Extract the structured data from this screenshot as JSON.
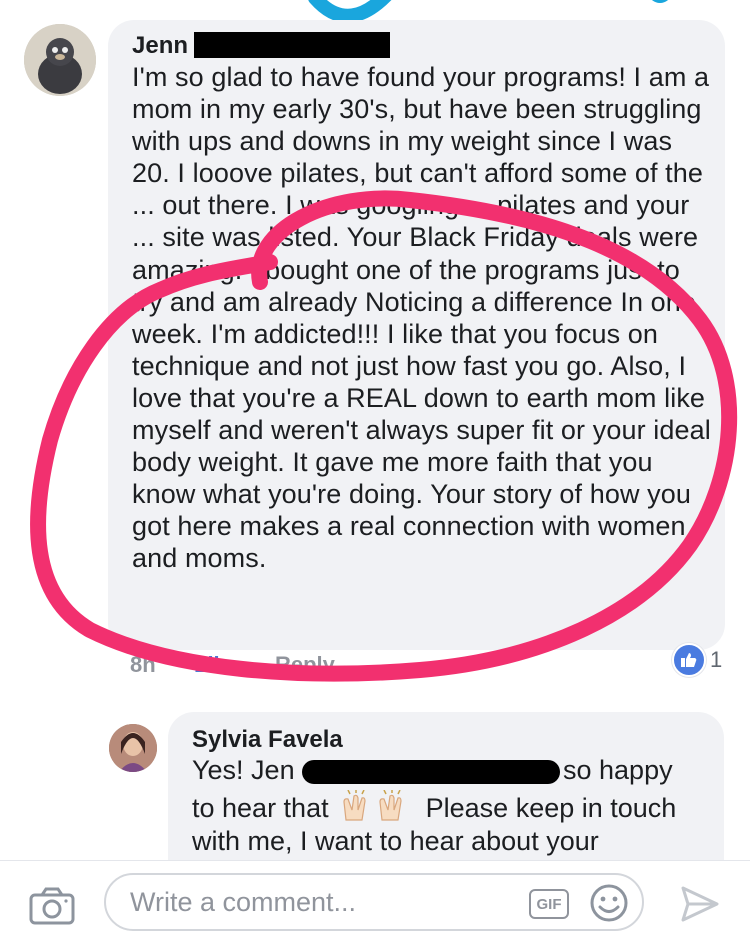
{
  "comment": {
    "author_visible": "Jenn",
    "text": "I'm so glad to have found your programs! I am a mom in my early 30's, but have been struggling with ups and downs in my weight since I was 20. I looove pilates, but can't afford some of the ... out there. I was googling ... pilates and your ... site was listed. Your Black Friday deals were amazing. I bought one of the programs just to try and am already Noticing a difference In one week. I'm addicted!!! I like that you focus on technique and not just how fast you go. Also, I love that you're a REAL down to earth mom like myself and weren't always super fit or your ideal body weight. It gave me more faith that you know what you're doing. Your story of how you got here makes a real connection with women and moms.",
    "time": "8h",
    "like_label": "Like",
    "reply_label": "Reply",
    "reaction_count": "1"
  },
  "reply": {
    "author": "Sylvia Favela",
    "line1_start": "Yes! Jen",
    "line1_end": "so happy",
    "line2_start": "to hear that",
    "line2_end": "Please keep in touch",
    "line3": "with me, I want to hear about your"
  },
  "composer": {
    "placeholder": "Write a comment...",
    "gif_label": "GIF"
  },
  "colors": {
    "highlight_circle": "#f2306f",
    "like_blue": "#4a77d4",
    "bubble_bg": "#f1f2f5"
  },
  "icons": [
    "camera-icon",
    "gif-icon",
    "emoji-icon",
    "send-icon",
    "thumbs-up-icon",
    "clapping-hands-icon"
  ]
}
